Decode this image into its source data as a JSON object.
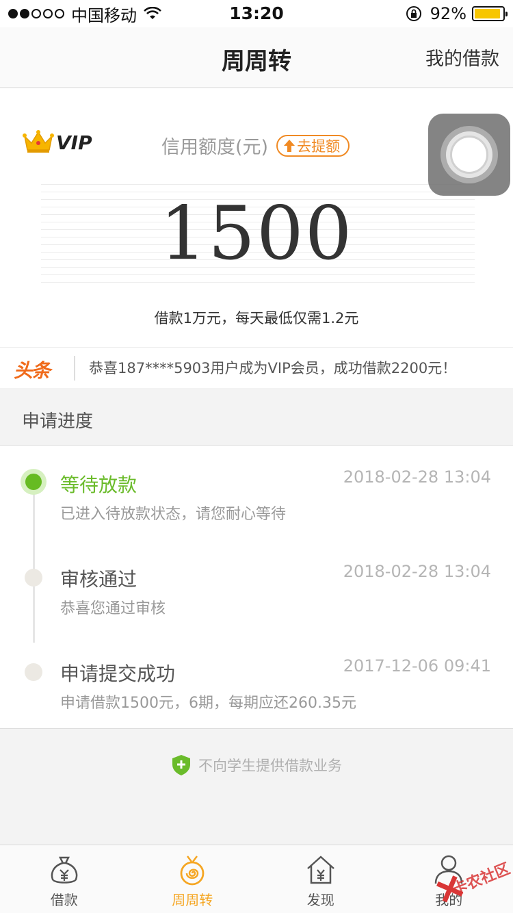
{
  "status_bar": {
    "carrier": "中国移动",
    "time": "13:20",
    "battery": "92%",
    "battery_level": 0.92,
    "signal_bars_filled": 2,
    "signal_bars_total": 5
  },
  "nav": {
    "title": "周周转",
    "right_action": "我的借款"
  },
  "credit": {
    "vip_label": "VIP",
    "label": "信用额度(元)",
    "raise_button": "去提额",
    "amount": "1500",
    "promo": "借款1万元，每天最低仅需1.2元"
  },
  "news": {
    "logo": "头条",
    "text": "恭喜187****5903用户成为VIP会员，成功借款2200元！"
  },
  "progress": {
    "title": "申请进度",
    "steps": [
      {
        "title": "等待放款",
        "desc": "已进入待放款状态，请您耐心等待",
        "time": "2018-02-28 13:04",
        "active": true
      },
      {
        "title": "审核通过",
        "desc": "恭喜您通过审核",
        "time": "2018-02-28 13:04",
        "active": false
      },
      {
        "title": "申请提交成功",
        "desc": "申请借款1500元，6期，每期应还260.35元",
        "time": "2017-12-06 09:41",
        "active": false
      }
    ]
  },
  "notice": {
    "text": "不向学生提供借款业务"
  },
  "tabs": [
    {
      "label": "借款",
      "icon": "money-bag-icon",
      "active": false
    },
    {
      "label": "周周转",
      "icon": "spiral-coin-icon",
      "active": true
    },
    {
      "label": "发现",
      "icon": "house-icon",
      "active": false
    },
    {
      "label": "我的",
      "icon": "person-icon",
      "active": false
    }
  ],
  "watermark": "卡农社区",
  "colors": {
    "accent_orange": "#f08a24",
    "active_green": "#66bb22",
    "tab_active": "#f5a623",
    "battery": "#f7c600"
  }
}
